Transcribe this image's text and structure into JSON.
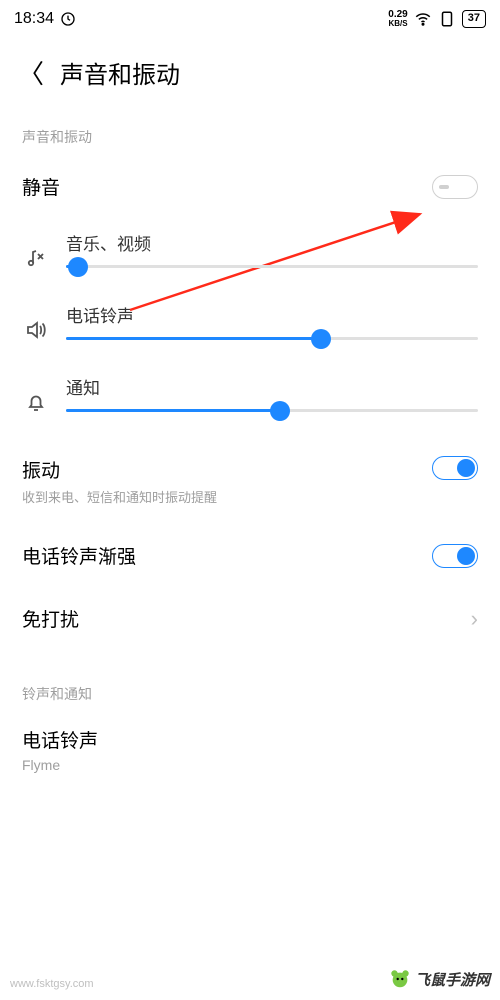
{
  "status": {
    "time": "18:34",
    "net_speed_value": "0.29",
    "net_speed_label": "KB/S",
    "battery": "37"
  },
  "nav": {
    "title": "声音和振动"
  },
  "sections": {
    "sound_vibration_header": "声音和振动",
    "ringtone_notification_header": "铃声和通知"
  },
  "silent": {
    "label": "静音",
    "enabled": false
  },
  "sliders": {
    "media": {
      "label": "音乐、视频",
      "value": 3
    },
    "ringtone": {
      "label": "电话铃声",
      "value": 62
    },
    "notification": {
      "label": "通知",
      "value": 52
    }
  },
  "vibration": {
    "label": "振动",
    "sub": "收到来电、短信和通知时振动提醒",
    "enabled": true
  },
  "ring_fade": {
    "label": "电话铃声渐强",
    "enabled": true
  },
  "dnd": {
    "label": "免打扰"
  },
  "phone_ringtone": {
    "label": "电话铃声",
    "value": "Flyme"
  },
  "watermark": {
    "left": "www.fsktgsy.com",
    "right": "飞鼠手游网"
  },
  "colors": {
    "accent": "#1e88ff",
    "arrow": "#ff2a1a"
  }
}
